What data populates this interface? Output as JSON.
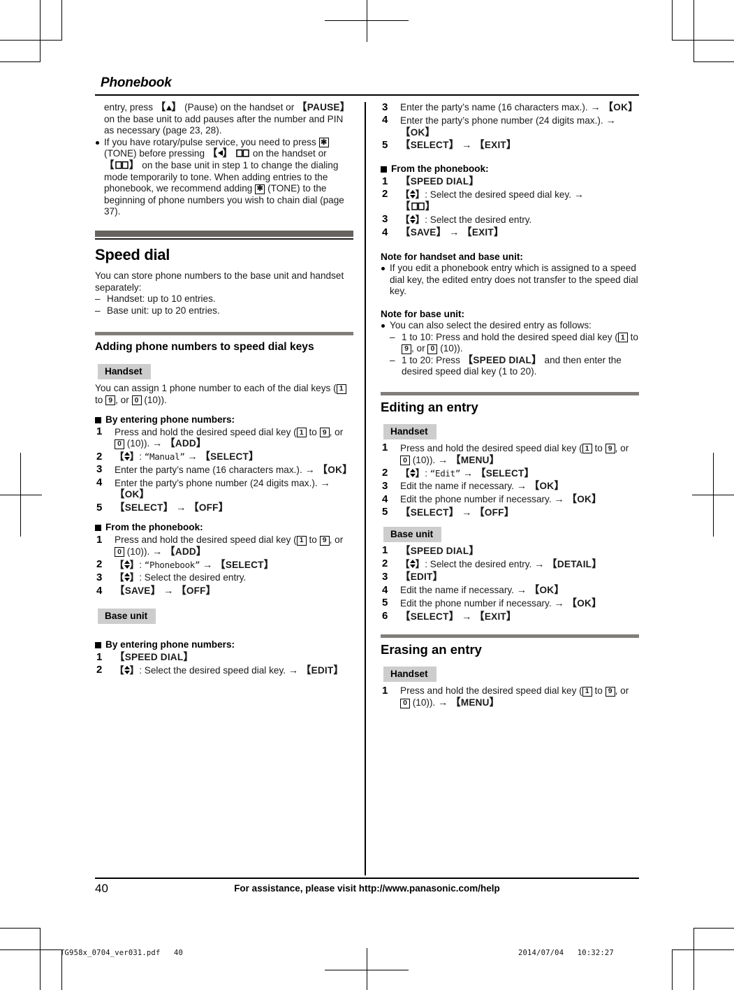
{
  "document": {
    "chapter_title": "Phonebook",
    "page_number": "40",
    "footer_assistance": "For assistance, please visit http://www.panasonic.com/help",
    "slug_left": "TG958x_0704_ver031.pdf   40",
    "slug_right": "2014/07/04   10:32:27"
  },
  "colors": {
    "divider_bar": "#66645f",
    "subdivider_bar": "#807e79",
    "badge_bg": "#cdcdcd",
    "rule": "#000000",
    "text": "#1a1a1a"
  },
  "left_column": {
    "continued_paragraph": {
      "pre_key": "entry, press ",
      "key_pause_handset": "Pause",
      "mid1": " on the handset or ",
      "key_pause_base": "PAUSE",
      "tail": " on the base unit to add pauses after the number and PIN as necessary (page 23, 28)."
    },
    "bullet_rotary": {
      "t1": "If you have rotary/pulse service, you need to press ",
      "star": "TONE",
      "t2": " (TONE) before pressing ",
      "t3": " on the handset or ",
      "t4": " on the base unit in step 1 to change the dialing mode temporarily to tone. When adding entries to the phonebook, we recommend adding ",
      "t5": " (TONE) to the beginning of phone numbers you wish to chain dial (page 37)."
    },
    "speed_dial": {
      "section_title": "Speed dial",
      "intro": "You can store phone numbers to the base unit and handset separately:",
      "limits": [
        "Handset: up to 10 entries.",
        "Base unit: up to 20 entries."
      ]
    },
    "adding": {
      "subsection_title": "Adding phone numbers to speed dial keys",
      "handset_badge": "Handset",
      "handset_intro_pre": "You can assign 1 phone number to each of the dial keys (",
      "handset_intro_post": " (10)).",
      "by_entering_heading": "By entering phone numbers:",
      "handset_entering_steps": [
        {
          "n": "1",
          "text_pre": "Press and hold the desired speed dial key (",
          "text_post": " (10)). ",
          "key": "ADD"
        },
        {
          "n": "2",
          "nav": true,
          "quote": "Manual",
          "key": "SELECT"
        },
        {
          "n": "3",
          "text": "Enter the party’s name (16 characters max.). ",
          "key": "OK"
        },
        {
          "n": "4",
          "text": "Enter the party’s phone number (24 digits max.). ",
          "key": "OK"
        },
        {
          "n": "5",
          "key_only": true,
          "key1": "SELECT",
          "key2": "OFF"
        }
      ],
      "from_phonebook_heading": "From the phonebook:",
      "handset_phonebook_steps": [
        {
          "n": "1",
          "text_pre": "Press and hold the desired speed dial key (",
          "text_post": " (10)). ",
          "key": "ADD"
        },
        {
          "n": "2",
          "nav": true,
          "quote": "Phonebook",
          "key": "SELECT"
        },
        {
          "n": "3",
          "nav": true,
          "text": "Select the desired entry."
        },
        {
          "n": "4",
          "key_only": true,
          "key1": "SAVE",
          "key2": "OFF"
        }
      ],
      "base_badge": "Base unit",
      "base_entering_heading": "By entering phone numbers:",
      "base_entering_steps": [
        {
          "n": "1",
          "key_only_single": true,
          "key1": "SPEED DIAL"
        },
        {
          "n": "2",
          "nav": true,
          "text": "Select the desired speed dial key. ",
          "key": "EDIT"
        }
      ]
    }
  },
  "right_column": {
    "base_entering_steps_cont": [
      {
        "n": "3",
        "text": "Enter the party’s name (16 characters max.). ",
        "key": "OK"
      },
      {
        "n": "4",
        "text": "Enter the party’s phone number (24 digits max.). ",
        "key": "OK"
      },
      {
        "n": "5",
        "key_only": true,
        "key1": "SELECT",
        "key2": "EXIT"
      }
    ],
    "base_from_phonebook_heading": "From the phonebook:",
    "base_phonebook_steps": [
      {
        "n": "1",
        "key_only_single": true,
        "key1": "SPEED DIAL"
      },
      {
        "n": "2",
        "nav": true,
        "text": "Select the desired speed dial key. ",
        "book_key": true
      },
      {
        "n": "3",
        "nav": true,
        "text": "Select the desired entry."
      },
      {
        "n": "4",
        "key_only": true,
        "key1": "SAVE",
        "key2": "EXIT"
      }
    ],
    "note_handset_base": {
      "heading": "Note for handset and base unit:",
      "bullet": "If you edit a phonebook entry which is assigned to a speed dial key, the edited entry does not transfer to the speed dial key."
    },
    "note_base": {
      "heading": "Note for base unit:",
      "bullet": "You can also select the desired entry as follows:",
      "sub1_pre": "1 to 10: Press and hold the desired speed dial key (",
      "sub1_post": " (10)).",
      "sub2_pre": "1 to 20: Press ",
      "sub2_key": "SPEED DIAL",
      "sub2_post": " and then enter the desired speed dial key (1 to 20)."
    },
    "editing": {
      "section_title": "Editing an entry",
      "handset_badge": "Handset",
      "handset_steps": [
        {
          "n": "1",
          "text_pre": "Press and hold the desired speed dial key (",
          "text_post": " (10)). ",
          "key": "MENU"
        },
        {
          "n": "2",
          "nav": true,
          "quote": "Edit",
          "key": "SELECT"
        },
        {
          "n": "3",
          "text": "Edit the name if necessary. ",
          "key": "OK"
        },
        {
          "n": "4",
          "text": "Edit the phone number if necessary. ",
          "key": "OK"
        },
        {
          "n": "5",
          "key_only": true,
          "key1": "SELECT",
          "key2": "OFF"
        }
      ],
      "base_badge": "Base unit",
      "base_steps": [
        {
          "n": "1",
          "key_only_single": true,
          "key1": "SPEED DIAL"
        },
        {
          "n": "2",
          "nav": true,
          "text": "Select the desired entry. ",
          "key": "DETAIL"
        },
        {
          "n": "3",
          "key_only_single": true,
          "key1": "EDIT"
        },
        {
          "n": "4",
          "text": "Edit the name if necessary. ",
          "key": "OK"
        },
        {
          "n": "5",
          "text": "Edit the phone number if necessary. ",
          "key": "OK"
        },
        {
          "n": "6",
          "key_only": true,
          "key1": "SELECT",
          "key2": "EXIT"
        }
      ]
    },
    "erasing": {
      "section_title": "Erasing an entry",
      "handset_badge": "Handset",
      "handset_steps": [
        {
          "n": "1",
          "text_pre": "Press and hold the desired speed dial key (",
          "text_post": " (10)). ",
          "key": "MENU"
        }
      ]
    }
  },
  "glyphs": {
    "dial_key_1": "1",
    "dial_key_9": "9",
    "dial_key_0": "0",
    "star_key": "✳",
    "to": " to ",
    "or": ", or ",
    "arrow": "→"
  }
}
